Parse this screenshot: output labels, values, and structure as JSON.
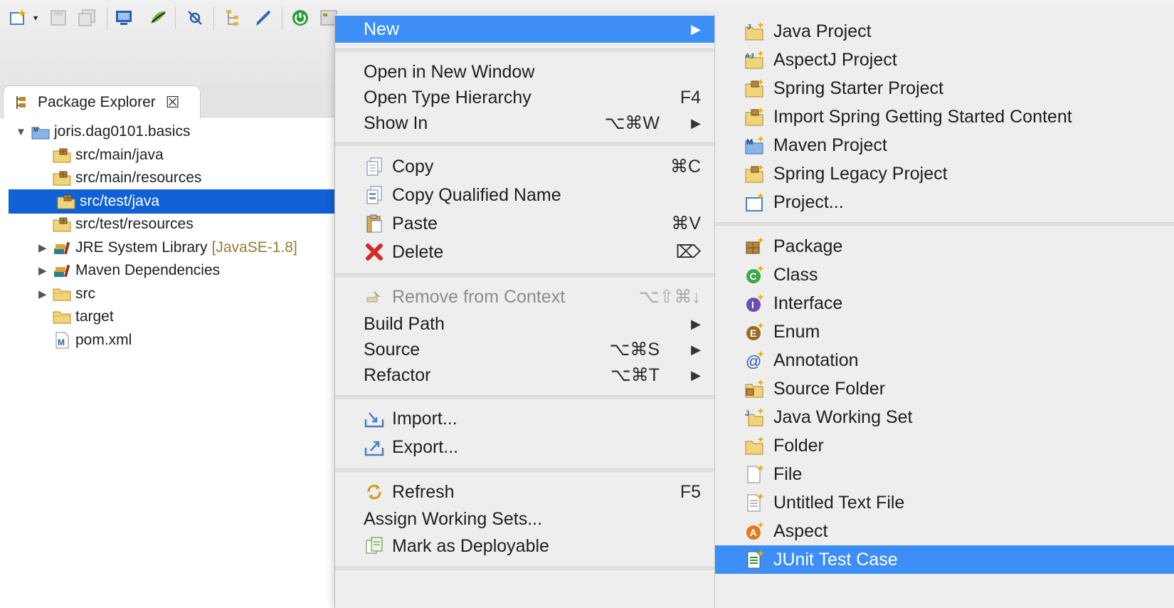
{
  "colors": {
    "selection_tree": "#1060d6",
    "menu_highlight": "#3d8ef7",
    "library_decoration": "#9a7a36"
  },
  "toolbar": {
    "buttons": [
      "new-wizard-icon",
      "save-icon",
      "save-all-icon",
      "terminal-icon",
      "spring-icon",
      "skip-breakpoints-icon",
      "hierarchy-icon",
      "pen-icon",
      "spring-boot-icon",
      "package-explorer-icon"
    ]
  },
  "package_explorer": {
    "tab_label": "Package Explorer",
    "tab_close_glyph": "☒",
    "tree": [
      {
        "label": "joris.dag0101.basics",
        "icon": "maven-project-icon",
        "expanded": true
      },
      {
        "label": "src/main/java",
        "icon": "source-folder-icon"
      },
      {
        "label": "src/main/resources",
        "icon": "source-folder-icon"
      },
      {
        "label": "src/test/java",
        "icon": "source-folder-icon",
        "selected": true
      },
      {
        "label": "src/test/resources",
        "icon": "source-folder-icon"
      },
      {
        "label": "JRE System Library",
        "decoration": "[JavaSE-1.8]",
        "icon": "library-icon",
        "expandable": true
      },
      {
        "label": "Maven Dependencies",
        "icon": "library-icon",
        "expandable": true
      },
      {
        "label": "src",
        "icon": "folder-icon",
        "expandable": true
      },
      {
        "label": "target",
        "icon": "folder-icon"
      },
      {
        "label": "pom.xml",
        "icon": "maven-file-icon"
      }
    ]
  },
  "context_menu": {
    "items": [
      {
        "label": "New",
        "arrow": "▶",
        "active": true
      },
      {
        "label": "Open in New Window"
      },
      {
        "label": "Open Type Hierarchy",
        "shortcut": "F4"
      },
      {
        "label": "Show In",
        "shortcut": "⌥⌘W",
        "arrow": "▶"
      },
      {
        "label": "Copy",
        "shortcut": "⌘C",
        "icon": "copy-icon"
      },
      {
        "label": "Copy Qualified Name",
        "icon": "copy-qualified-name-icon"
      },
      {
        "label": "Paste",
        "shortcut": "⌘V",
        "icon": "paste-icon"
      },
      {
        "label": "Delete",
        "shortcut": "⌦",
        "icon": "delete-icon"
      },
      {
        "label": "Remove from Context",
        "shortcut": "⌥⇧⌘↓",
        "icon": "remove-from-context-icon",
        "disabled": true
      },
      {
        "label": "Build Path",
        "arrow": "▶"
      },
      {
        "label": "Source",
        "shortcut": "⌥⌘S",
        "arrow": "▶"
      },
      {
        "label": "Refactor",
        "shortcut": "⌥⌘T",
        "arrow": "▶"
      },
      {
        "label": "Import...",
        "icon": "import-icon"
      },
      {
        "label": "Export...",
        "icon": "export-icon"
      },
      {
        "label": "Refresh",
        "shortcut": "F5",
        "icon": "refresh-icon"
      },
      {
        "label": "Assign Working Sets..."
      },
      {
        "label": "Mark as Deployable",
        "icon": "mark-deployable-icon"
      }
    ]
  },
  "new_submenu": {
    "items": [
      {
        "label": "Java Project",
        "icon": "java-project-icon"
      },
      {
        "label": "AspectJ Project",
        "icon": "aspectj-project-icon"
      },
      {
        "label": "Spring Starter Project",
        "icon": "spring-starter-icon"
      },
      {
        "label": "Import Spring Getting Started Content",
        "icon": "spring-import-icon"
      },
      {
        "label": "Maven Project",
        "icon": "maven-project-icon"
      },
      {
        "label": "Spring Legacy Project",
        "icon": "spring-legacy-icon"
      },
      {
        "label": "Project...",
        "icon": "new-project-icon"
      },
      {
        "label": "Package",
        "icon": "package-icon"
      },
      {
        "label": "Class",
        "icon": "class-icon"
      },
      {
        "label": "Interface",
        "icon": "interface-icon"
      },
      {
        "label": "Enum",
        "icon": "enum-icon"
      },
      {
        "label": "Annotation",
        "icon": "annotation-icon"
      },
      {
        "label": "Source Folder",
        "icon": "source-folder-icon"
      },
      {
        "label": "Java Working Set",
        "icon": "java-working-set-icon"
      },
      {
        "label": "Folder",
        "icon": "folder-icon"
      },
      {
        "label": "File",
        "icon": "file-icon"
      },
      {
        "label": "Untitled Text File",
        "icon": "text-file-icon"
      },
      {
        "label": "Aspect",
        "icon": "aspect-icon"
      },
      {
        "label": "JUnit Test Case",
        "icon": "junit-test-case-icon",
        "active": true
      }
    ]
  }
}
